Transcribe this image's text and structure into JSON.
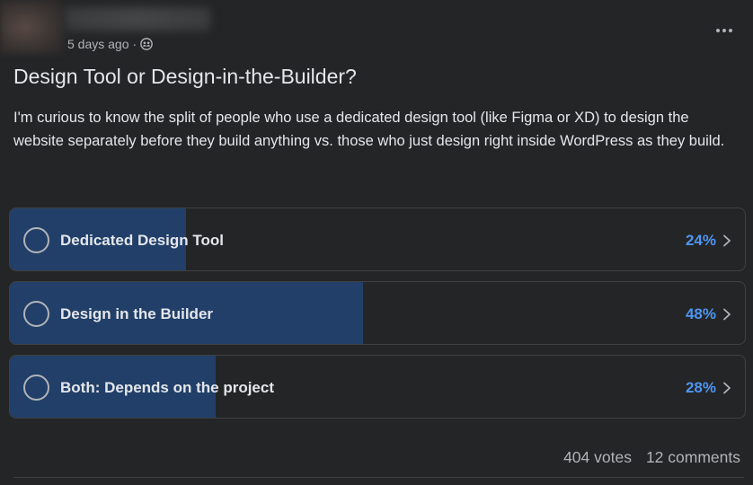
{
  "post": {
    "timestamp": "5 days ago",
    "separator": "·",
    "audience_icon": "group-icon",
    "more_icon": "more-horizontal-icon",
    "title": "Design Tool or Design-in-the-Builder?",
    "description": "I'm curious to know the split of people who use a dedicated design tool (like Figma or XD) to design the website separately before they build anything vs. those who just design right inside WordPress as they build."
  },
  "poll": {
    "fill_color": "#213f68",
    "percent_color": "#4d95f3",
    "options": [
      {
        "label": "Dedicated Design Tool",
        "percent_text": "24%",
        "percent": 24
      },
      {
        "label": "Design in the Builder",
        "percent_text": "48%",
        "percent": 48
      },
      {
        "label": "Both: Depends on the project",
        "percent_text": "28%",
        "percent": 28
      }
    ]
  },
  "footer": {
    "votes": "404 votes",
    "comments": "12 comments"
  }
}
